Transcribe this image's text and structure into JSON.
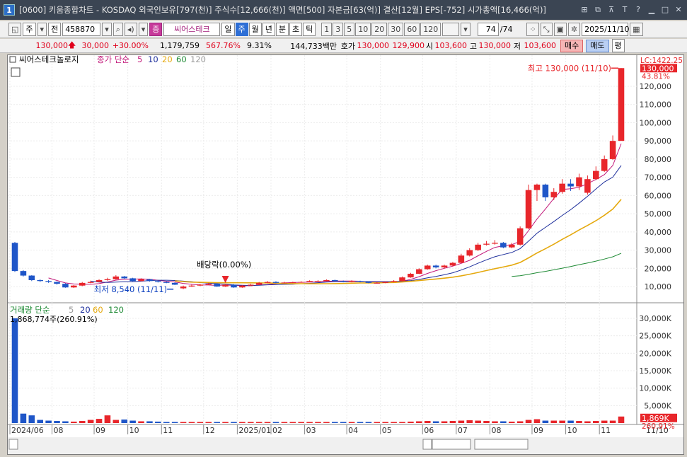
{
  "title": {
    "window_num": "1",
    "text": "[0600] 키움종합차트 - KOSDAQ 외국인보유[797(천)] 주식수[12,666(천)] 액면[500] 자본금[63(억)] 결산[12월] EPS[-752] 시가총액[16,466(억)]"
  },
  "toolbar": {
    "period_label": "주",
    "prev_label": "전",
    "code": "458870",
    "stock_name": "씨어스테크",
    "periods": [
      "일",
      "주",
      "월",
      "년",
      "분",
      "초",
      "틱"
    ],
    "selected_period": "주",
    "intervals": [
      "1",
      "3",
      "5",
      "10",
      "20",
      "30",
      "60",
      "120"
    ],
    "count_display": "74",
    "count_total": "/74",
    "date": "2025/11/10"
  },
  "quote": {
    "price": "130,000",
    "change": "30,000",
    "change_pct": "+30.00%",
    "volume": "1,179,759",
    "volume_ratio": "567.76%",
    "turnover": "9.31%",
    "amount": "144,733백만",
    "ask_label": "호가",
    "ask": "130,000",
    "bid": "129,900",
    "open_label": "시",
    "open": "103,600",
    "high_label": "고",
    "high": "130,000",
    "low_label": "저",
    "low": "103,600",
    "buy_label": "매수",
    "sell_label": "매도",
    "eval_label": "평"
  },
  "price_panel": {
    "name": "씨어스테크놀로지",
    "ma_label": "종가 단순",
    "ma_periods": [
      "5",
      "10",
      "20",
      "60",
      "120"
    ],
    "ma_colors": [
      "#c2187a",
      "#1e2f9c",
      "#e5a90e",
      "#1e8a34",
      "#9a9a9a"
    ],
    "lc_label": "LC:1422.25",
    "last_price_tag": "130,000",
    "last_pct_tag": "43.81%",
    "high_annotation": "최고 130,000 (11/10)",
    "low_annotation": "최저 8,540 (11/11)",
    "event_annotation": "배당락(0.00%)",
    "y_ticks": [
      "120,000",
      "110,000",
      "100,000",
      "90,000",
      "80,000",
      "70,000",
      "60,000",
      "50,000",
      "40,000",
      "30,000",
      "20,000",
      "10,000"
    ]
  },
  "volume_panel": {
    "label": "거래량 단순",
    "ma_periods": [
      "5",
      "20",
      "60",
      "120"
    ],
    "value_label": "1,868,774주(260.91%)",
    "last_tag": "1,869K",
    "pct_tag": "260.91%",
    "y_ticks": [
      "30,000K",
      "25,000K",
      "20,000K",
      "15,000K",
      "10,000K",
      "5,000K"
    ]
  },
  "x_axis": {
    "labels": [
      "2024/06",
      "08",
      "09",
      "10",
      "11",
      "12",
      "2025/01",
      "02",
      "03",
      "04",
      "05",
      "06",
      "07",
      "08",
      "09",
      "10",
      "11"
    ],
    "right_label": "11/10"
  },
  "chart_data": {
    "type": "candlestick",
    "x": [
      "2024/06/28",
      "2024/07/05",
      "2024/07/12",
      "2024/07/19",
      "2024/07/26",
      "2024/08/02",
      "2024/08/09",
      "2024/08/16",
      "2024/08/23",
      "2024/08/30",
      "2024/09/06",
      "2024/09/13",
      "2024/09/20",
      "2024/09/27",
      "2024/10/04",
      "2024/10/11",
      "2024/10/18",
      "2024/10/25",
      "2024/11/01",
      "2024/11/08",
      "2024/11/15",
      "2024/11/22",
      "2024/11/29",
      "2024/12/06",
      "2024/12/13",
      "2024/12/20",
      "2024/12/27",
      "2025/01/03",
      "2025/01/10",
      "2025/01/17",
      "2025/01/24",
      "2025/01/31",
      "2025/02/07",
      "2025/02/14",
      "2025/02/21",
      "2025/02/28",
      "2025/03/07",
      "2025/03/14",
      "2025/03/21",
      "2025/03/28",
      "2025/04/04",
      "2025/04/11",
      "2025/04/18",
      "2025/04/25",
      "2025/05/02",
      "2025/05/09",
      "2025/05/16",
      "2025/05/23",
      "2025/05/30",
      "2025/06/06",
      "2025/06/13",
      "2025/06/20",
      "2025/06/27",
      "2025/07/04",
      "2025/07/11",
      "2025/07/18",
      "2025/07/25",
      "2025/08/01",
      "2025/08/08",
      "2025/08/15",
      "2025/08/22",
      "2025/08/29",
      "2025/09/05",
      "2025/09/12",
      "2025/09/19",
      "2025/09/26",
      "2025/10/03",
      "2025/10/10",
      "2025/10/17",
      "2025/10/24",
      "2025/10/31",
      "2025/11/07",
      "2025/11/10"
    ],
    "open": [
      34000,
      18500,
      16000,
      13500,
      13000,
      12500,
      11500,
      9500,
      10500,
      12000,
      12500,
      13500,
      14000,
      15500,
      14500,
      13000,
      14000,
      13000,
      12500,
      12000,
      9000,
      10000,
      10500,
      11000,
      11500,
      10000,
      11000,
      9500,
      10500,
      11000,
      12000,
      12500,
      12000,
      12200,
      12300,
      12500,
      13000,
      13000,
      13500,
      13000,
      12500,
      13000,
      12500,
      12000,
      12000,
      12500,
      13000,
      15000,
      17000,
      19500,
      21500,
      20500,
      21500,
      23000,
      27000,
      30000,
      33000,
      33500,
      34000,
      31500,
      33000,
      42000,
      63000,
      66000,
      59000,
      62000,
      66500,
      65000,
      61500,
      69000,
      73500,
      80000,
      90000
    ],
    "close": [
      18500,
      16000,
      13500,
      13000,
      12500,
      11500,
      9500,
      10500,
      12000,
      12500,
      13500,
      14000,
      15500,
      14500,
      13000,
      14000,
      13000,
      12500,
      12000,
      11000,
      10000,
      10500,
      11000,
      11500,
      10000,
      11000,
      9500,
      10500,
      11000,
      12000,
      12500,
      12000,
      12200,
      12300,
      12500,
      13000,
      13000,
      13500,
      13000,
      12500,
      13000,
      12500,
      12000,
      12000,
      12500,
      13000,
      15000,
      17000,
      19500,
      21500,
      20500,
      21500,
      23000,
      27000,
      30000,
      33000,
      33500,
      34000,
      31500,
      33000,
      42000,
      63000,
      66000,
      59000,
      62000,
      66500,
      65000,
      70000,
      69000,
      73500,
      80000,
      90000,
      130000
    ],
    "high": [
      34500,
      19000,
      16200,
      14000,
      13500,
      12800,
      11800,
      10800,
      12500,
      13200,
      14000,
      14800,
      16200,
      15800,
      14800,
      14500,
      14200,
      13300,
      12900,
      12300,
      10500,
      11000,
      11500,
      12000,
      11800,
      11400,
      11300,
      10800,
      11500,
      12500,
      13000,
      12900,
      12600,
      12600,
      12900,
      13400,
      13500,
      13900,
      13800,
      13300,
      13400,
      13200,
      12800,
      12400,
      12800,
      13500,
      15500,
      17500,
      20000,
      22000,
      22000,
      22000,
      23500,
      28000,
      31000,
      34000,
      35000,
      35500,
      34500,
      34000,
      43000,
      66000,
      66500,
      66500,
      64000,
      69000,
      69000,
      72000,
      71000,
      76000,
      82000,
      93000,
      130000
    ],
    "low": [
      18000,
      15500,
      13000,
      12500,
      12000,
      11000,
      9300,
      9200,
      10200,
      11800,
      12300,
      13200,
      13800,
      14200,
      12800,
      12800,
      12700,
      12200,
      11800,
      10800,
      8540,
      9800,
      10200,
      10800,
      9800,
      9800,
      9300,
      9300,
      10200,
      10800,
      11800,
      11800,
      11800,
      11900,
      12100,
      12300,
      12700,
      12800,
      12800,
      12300,
      12300,
      12300,
      11800,
      11700,
      11800,
      12300,
      12800,
      14800,
      16800,
      19200,
      20000,
      20000,
      21000,
      22800,
      26500,
      29500,
      32500,
      33000,
      31000,
      31000,
      32500,
      41500,
      57000,
      57000,
      57500,
      61000,
      62500,
      63000,
      60500,
      68500,
      73000,
      79500,
      103600
    ]
  }
}
